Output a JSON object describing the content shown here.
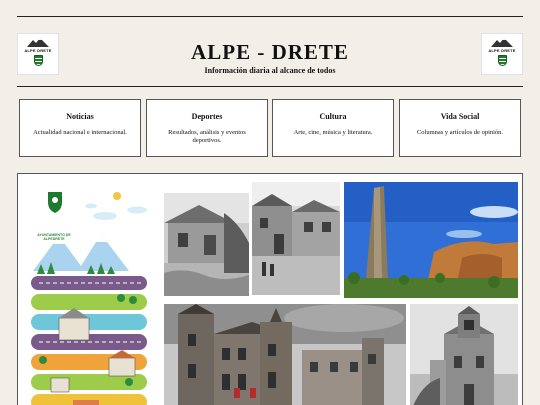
{
  "header": {
    "title": "ALPE - DRETE",
    "subtitle": "Información diaria al alcance de todos",
    "logo_text": "ALPE DRETE"
  },
  "sections": [
    {
      "title": "Noticias",
      "description": "Actualidad nacional e internacional."
    },
    {
      "title": "Deportes",
      "description": "Resultados, análisis y eventos deportivos."
    },
    {
      "title": "Cultura",
      "description": "Arte, cine, música y literatura."
    },
    {
      "title": "Vida Social",
      "description": "Columnas y artículos de opinión."
    }
  ],
  "gallery": {
    "poster_label": "AYUNTAMIENTO DE ALPEDRETE"
  },
  "colors": {
    "page_bg": "#f2efe9",
    "accent_green": "#1f7a2e",
    "sky_blue": "#2f6fd6"
  }
}
